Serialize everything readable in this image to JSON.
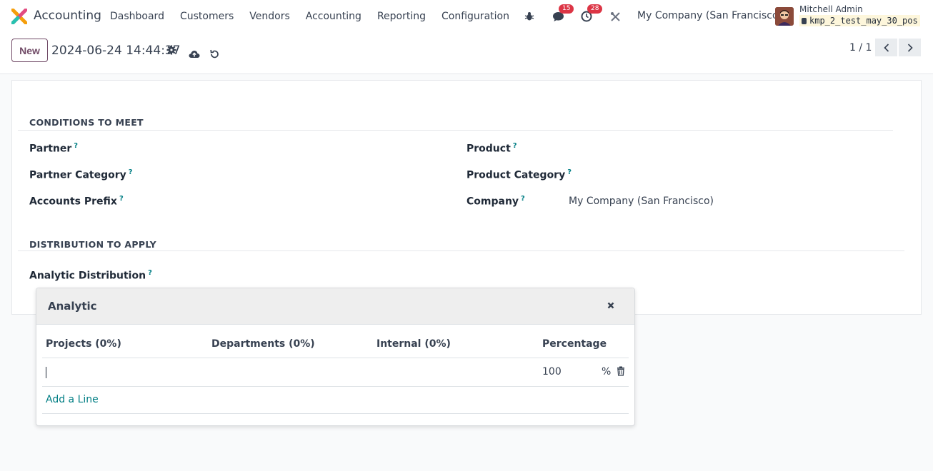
{
  "navbar": {
    "app_name": "Accounting",
    "menu": [
      "Dashboard",
      "Customers",
      "Vendors",
      "Accounting",
      "Reporting",
      "Configuration"
    ],
    "messages_count": "15",
    "activities_count": "28",
    "company": "My Company (San Francisco)",
    "user_name": "Mitchell Admin",
    "db_name": "kmp_2_test_may_30_pos",
    "icons": [
      "bug-icon",
      "chat-icon",
      "clock-icon",
      "tools-icon"
    ]
  },
  "control": {
    "new_label": "New",
    "record_title": "2024-06-24 14:44:37",
    "pager": "1 / 1"
  },
  "form": {
    "section_conditions": "CONDITIONS TO MEET",
    "section_distribution": "DISTRIBUTION TO APPLY",
    "help_mark": "?",
    "fields": {
      "partner": "Partner",
      "partner_category": "Partner Category",
      "accounts_prefix": "Accounts Prefix",
      "product": "Product",
      "product_category": "Product Category",
      "company": "Company",
      "company_value": "My Company (San Francisco)",
      "analytic_distribution": "Analytic Distribution"
    }
  },
  "popover": {
    "title": "Analytic",
    "columns": [
      "Projects (0%)",
      "Departments (0%)",
      "Internal (0%)",
      "Percentage"
    ],
    "row": {
      "percentage": "100",
      "unit": "%"
    },
    "add_line": "Add a Line"
  },
  "colors": {
    "brand": "#714b67",
    "link": "#017e84",
    "badge": "#dc3545"
  }
}
